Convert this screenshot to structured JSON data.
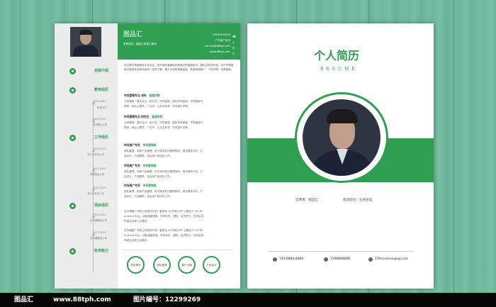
{
  "left_page": {
    "header": {
      "name": "图品汇",
      "subtitle": "求职意向：图品汇前端工程师",
      "contacts": [
        "13900135000",
        "广东省广州市",
        "service@88tph.com",
        "www.88tph.com"
      ]
    },
    "intro": "本人是市场营销专业毕业生，有丰富的营销知识和良好的营销技巧。团队合作意识强，对于市场营销方面的前沿和动向有一定的了解，善于分析和吸取经验，熟悉网络推广，个性开朗，容易相处。",
    "sections": {
      "profile": "自我介绍",
      "education": "教育经历",
      "work": "工作经历",
      "projects": "项目经历",
      "skills": "技术能力"
    },
    "education": [
      {
        "years": "2005-2009",
        "school": "科技大学",
        "title": "市场营销专业 本科",
        "role": "管理学院",
        "lines": [
          "主修课程：基本会计、统计学、市场营销、国际市场营销、市场调查与",
          "预测、商业心理学、广告学、公共关系学、货币银行学等。"
        ]
      },
      {
        "years": "2009-2012",
        "school": "华南理工大学",
        "title": "市场营销专业 研究生",
        "role": "管理学院",
        "lines": [
          "主修课程：基本会计、统计学、市场营销、国际市场营销、市场调查与",
          "预测、商业心理学、广告学、公共关系学、货币银行学等。"
        ]
      }
    ],
    "work": [
      {
        "years": "2012-2013",
        "company": "灵心沙文化公司",
        "title": "市场推广专员",
        "role": "市场营销部",
        "lines": [
          "团队管理，电商产品管理，电子商务知识管理策划，网站需求分析，产",
          "品设计，产品跟踪，及后续产品优化工作。"
        ]
      },
      {
        "years": "2012-2013",
        "company": "卓望信息公司",
        "title": "市场推广专员",
        "role": "市场营销部",
        "lines": [
          "团队管理，电商产品管理，电子商务知识管理策划，网站需求分析，产",
          "品设计，产品跟踪，及后续产品优化工作。"
        ]
      },
      {
        "years": "2012-2013",
        "company": "灵心沙文化公司",
        "title": "市场推广专员",
        "role": "市场营销部",
        "lines": [
          "团队管理，电商产品管理，电子商务知识管理策划，网站需求分析，产",
          "品设计，产品跟踪，及后续产品优化工作。"
        ]
      }
    ],
    "projects": [
      {
        "years": "2012-2013",
        "company": "石市通盈投公司",
        "lines": [
          "石市通盈广东某公司委托开发一套类似 58 同城 APP 主要这于 iOS 和",
          "Android 平台。功能涵盖频道、市场浏览、团购、会员积分、在线买卖、",
          "同城活动等几大模块。"
        ]
      },
      {
        "years": "2012-2013",
        "company": "石市通盈投公司",
        "lines": [
          "石市通盈广东某公司委托开发一套类似 58 同城 APP 主要这于 iOS 和",
          "Android 平台。功能涵盖频道、市场浏览、团购、会员积分、在线买卖、",
          "同城活动等几大模块。"
        ]
      }
    ],
    "skills": [
      "项目策划",
      "团队管理",
      "客户沟通",
      "产品设计"
    ]
  },
  "right_page": {
    "title": "个人简历",
    "subtitle": "RESUME",
    "name_label": "应聘者：图品汇",
    "position_label": "意向职位：业务总监",
    "contacts": [
      "159-8888-8888",
      "1398888888",
      "139xxxxxxx@qq.com"
    ]
  },
  "footer": {
    "logo": "图品汇",
    "url": "www.88tph.com",
    "id_label": "图片编号：",
    "id": "12299269"
  },
  "colors": {
    "accent": "#2f9f52",
    "background": "#74bca0",
    "footer": "#070707"
  }
}
